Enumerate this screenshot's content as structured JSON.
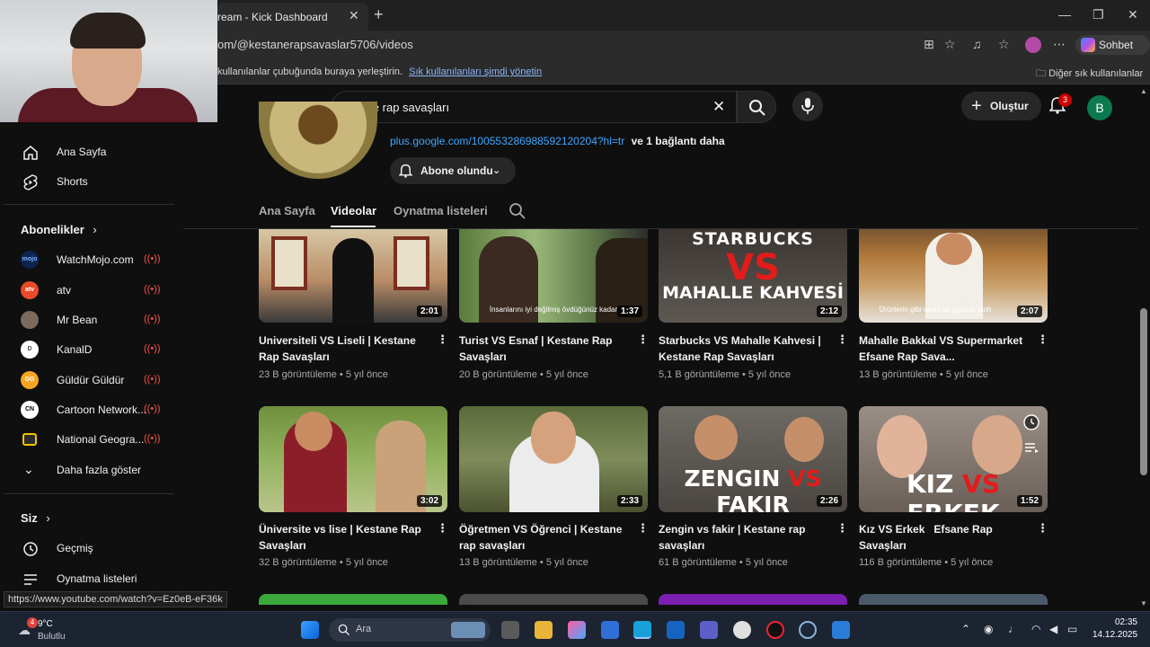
{
  "browser": {
    "tab_title": "ream - Kick Dashboard",
    "url": "om/@kestanerapsavaslar5706/videos",
    "bookmark_hint": "kullanılanlar çubuğunda buraya yerleştirin.",
    "bookmark_link": "Sık kullanılanları şimdi yönetin",
    "other_bookmarks": "Diğer sık kullanılanlar",
    "copilot_label": "Sohbet et"
  },
  "header": {
    "search_value": "efsane rap savaşları",
    "create_label": "Oluştur",
    "notification_count": "3",
    "avatar_letter": "B"
  },
  "sidebar": {
    "home": "Ana Sayfa",
    "shorts": "Shorts",
    "subscriptions_heading": "Abonelikler",
    "channels": [
      {
        "name": "WatchMojo.com",
        "avatar": "mojo",
        "color": "#1a3a6e"
      },
      {
        "name": "atv",
        "avatar": "atv",
        "color": "#e94b2a"
      },
      {
        "name": "Mr Bean",
        "avatar": "",
        "color": "#7d6a5a"
      },
      {
        "name": "KanalD",
        "avatar": "D",
        "color": "#ffffff"
      },
      {
        "name": "Güldür Güldür",
        "avatar": "GG",
        "color": "#f5a623"
      },
      {
        "name": "Cartoon Network...",
        "avatar": "CN",
        "color": "#ffffff"
      },
      {
        "name": "National Geogra...",
        "avatar": "",
        "color": "#f2c500"
      }
    ],
    "show_more": "Daha fazla göster",
    "you_heading": "Siz",
    "history": "Geçmiş",
    "playlists": "Oynatma listeleri"
  },
  "channel": {
    "link": "plus.google.com/100553286988592120204?hl=tr",
    "link_more": "ve 1 bağlantı daha",
    "subscribe_label": "Abone olundu",
    "tabs": [
      "Ana Sayfa",
      "Videolar",
      "Oynatma listeleri"
    ]
  },
  "videos": [
    {
      "title": "Universiteli VS Liseli | Kestane Rap Savaşları",
      "views": "23 B görüntüleme",
      "age": "5 yıl önce",
      "duration": "2:01",
      "thumb_text": "",
      "caption": ""
    },
    {
      "title": "Turist VS Esnaf | Kestane Rap Savaşları",
      "views": "20 B görüntüleme",
      "age": "5 yıl önce",
      "duration": "1:37",
      "thumb_text": "",
      "caption": "İnsanlarını iyi değilmiş övdüğünüz kadar"
    },
    {
      "title": "Starbucks VS Mahalle Kahvesi | Kestane Rap Savaşları",
      "views": "5,1 B görüntüleme",
      "age": "5 yıl önce",
      "duration": "2:12",
      "thumb_text": "STARBUCKS VS MAHALLE KAHVESİ",
      "caption": ""
    },
    {
      "title": "Mahalle Bakkal VS Supermarket Efsane Rap Sava...",
      "views": "13 B görüntüleme",
      "age": "5 yıl önce",
      "duration": "2:07",
      "thumb_text": "",
      "caption": "Ürünlerin gibi senin de geçmiş tarih"
    },
    {
      "title": "Üniversite vs lise | Kestane Rap Savaşları",
      "views": "32 B görüntüleme",
      "age": "5 yıl önce",
      "duration": "3:02",
      "thumb_text": "",
      "caption": ""
    },
    {
      "title": "Öğretmen VS Öğrenci | Kestane rap savaşları",
      "views": "13 B görüntüleme",
      "age": "5 yıl önce",
      "duration": "2:33",
      "thumb_text": "",
      "caption": ""
    },
    {
      "title": "Zengin vs fakir | Kestane rap savaşları",
      "views": "61 B görüntüleme",
      "age": "5 yıl önce",
      "duration": "2:26",
      "thumb_text": "ZENGIN VS FAKIR",
      "caption": ""
    },
    {
      "title": "Kız VS Erkek   Efsane Rap Savaşları",
      "views": "116 B görüntüleme",
      "age": "5 yıl önce",
      "duration": "1:52",
      "thumb_text": "KIZ VS ERKEK",
      "caption": ""
    }
  ],
  "status_url": "https://www.youtube.com/watch?v=Ez0eB-eF36k",
  "taskbar": {
    "weather_temp": "9°C",
    "weather_cond": "Bulutlu",
    "weather_badge": "4",
    "search_placeholder": "Ara",
    "time": "02:35",
    "date": "14.12.2025"
  },
  "colors": {
    "accent_link": "#3ea6ff",
    "live_red": "#ff4e45",
    "bg": "#0f0f0f"
  }
}
